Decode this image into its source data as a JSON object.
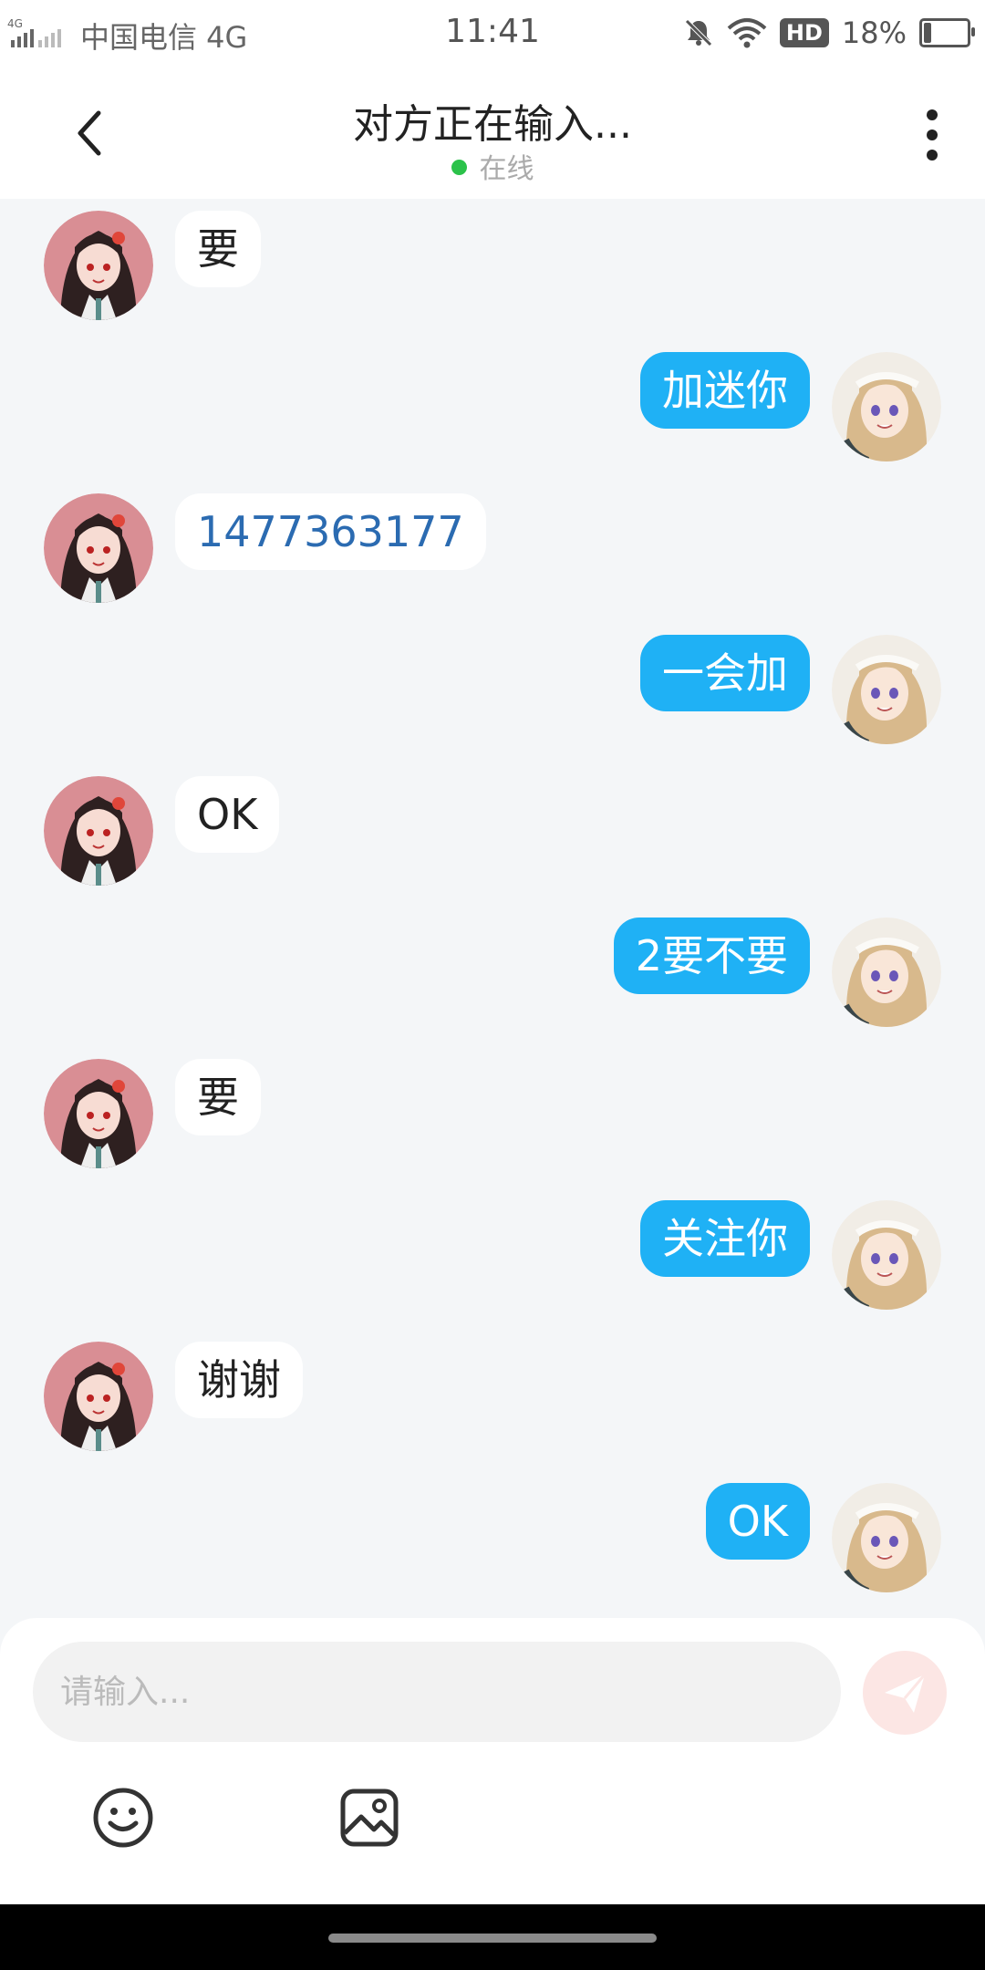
{
  "status_bar": {
    "network_type": "4G",
    "carrier": "中国电信 4G",
    "time": "11:41",
    "hd_badge": "HD",
    "battery_text": "18%",
    "battery_level": 0.18
  },
  "header": {
    "title": "对方正在输入...",
    "status": "在线",
    "status_color": "#2bc24a"
  },
  "messages": [
    {
      "side": "left",
      "text": "要"
    },
    {
      "side": "right",
      "text": "加迷你"
    },
    {
      "side": "left",
      "text": "1477363177",
      "is_link": true
    },
    {
      "side": "right",
      "text": "一会加"
    },
    {
      "side": "left",
      "text": "OK"
    },
    {
      "side": "right",
      "text": "2要不要"
    },
    {
      "side": "left",
      "text": "要"
    },
    {
      "side": "right",
      "text": "关注你"
    },
    {
      "side": "left",
      "text": "谢谢"
    },
    {
      "side": "right",
      "text": "OK"
    }
  ],
  "input": {
    "placeholder": "请输入...",
    "value": ""
  },
  "icons": {
    "back": "back-arrow-icon",
    "more": "more-vertical-icon",
    "send": "send-icon",
    "emoji": "emoji-icon",
    "image": "image-icon"
  },
  "colors": {
    "outgoing_bubble": "#1fb1f5",
    "incoming_bubble": "#ffffff",
    "link_text": "#2b6bb1",
    "background": "#f4f6f8",
    "send_button": "#fce6e4"
  }
}
